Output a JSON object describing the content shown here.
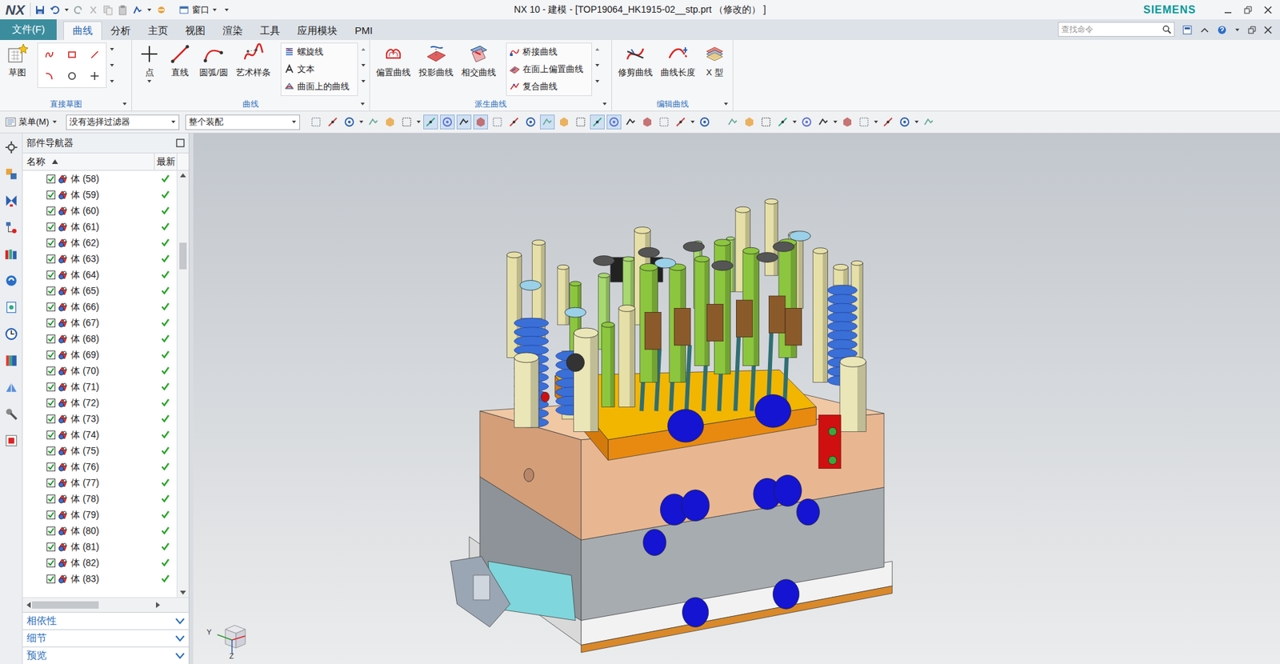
{
  "window": {
    "logo": "NX",
    "title": "NX 10 - 建模 - [TOP19064_HK1915-02__stp.prt （修改的） ]",
    "brand": "SIEMENS",
    "window_menu": "窗口"
  },
  "file_tab": "文件(F)",
  "tabs": [
    {
      "label": "曲线",
      "selected": true
    },
    {
      "label": "分析",
      "selected": false
    },
    {
      "label": "主页",
      "selected": false
    },
    {
      "label": "视图",
      "selected": false
    },
    {
      "label": "渲染",
      "selected": false
    },
    {
      "label": "工具",
      "selected": false
    },
    {
      "label": "应用模块",
      "selected": false
    },
    {
      "label": "PMI",
      "selected": false
    }
  ],
  "search": {
    "placeholder": "查找命令"
  },
  "ribbon": [
    {
      "label": "直接草图",
      "large": [
        {
          "label": "草图"
        }
      ],
      "small": []
    },
    {
      "label": "曲线",
      "large": [
        {
          "label": "点"
        },
        {
          "label": "直线"
        },
        {
          "label": "圆弧/圆"
        },
        {
          "label": "艺术样条"
        }
      ],
      "small": [
        {
          "label": "螺旋线"
        },
        {
          "label": "文本"
        },
        {
          "label": "曲面上的曲线"
        }
      ]
    },
    {
      "label": "派生曲线",
      "large": [
        {
          "label": "偏置曲线"
        },
        {
          "label": "投影曲线"
        },
        {
          "label": "相交曲线"
        }
      ],
      "small": [
        {
          "label": "桥接曲线"
        },
        {
          "label": "在面上偏置曲线"
        },
        {
          "label": "复合曲线"
        }
      ]
    },
    {
      "label": "编辑曲线",
      "large": [
        {
          "label": "修剪曲线"
        },
        {
          "label": "曲线长度"
        },
        {
          "label": "X 型"
        }
      ],
      "small": []
    }
  ],
  "toolbar": {
    "menu": "菜单(M)",
    "filter": "没有选择过滤器",
    "scope": "整个装配"
  },
  "navigator": {
    "title": "部件导航器",
    "columns": [
      "名称",
      "最新"
    ],
    "rows": [
      {
        "name": "体 (58)",
        "checked": true,
        "latest": true
      },
      {
        "name": "体 (59)",
        "checked": true,
        "latest": true
      },
      {
        "name": "体 (60)",
        "checked": true,
        "latest": true
      },
      {
        "name": "体 (61)",
        "checked": true,
        "latest": true
      },
      {
        "name": "体 (62)",
        "checked": true,
        "latest": true
      },
      {
        "name": "体 (63)",
        "checked": true,
        "latest": true
      },
      {
        "name": "体 (64)",
        "checked": true,
        "latest": true
      },
      {
        "name": "体 (65)",
        "checked": true,
        "latest": true
      },
      {
        "name": "体 (66)",
        "checked": true,
        "latest": true
      },
      {
        "name": "体 (67)",
        "checked": true,
        "latest": true
      },
      {
        "name": "体 (68)",
        "checked": true,
        "latest": true
      },
      {
        "name": "体 (69)",
        "checked": true,
        "latest": true
      },
      {
        "name": "体 (70)",
        "checked": true,
        "latest": true
      },
      {
        "name": "体 (71)",
        "checked": true,
        "latest": true
      },
      {
        "name": "体 (72)",
        "checked": true,
        "latest": true
      },
      {
        "name": "体 (73)",
        "checked": true,
        "latest": true
      },
      {
        "name": "体 (74)",
        "checked": true,
        "latest": true
      },
      {
        "name": "体 (75)",
        "checked": true,
        "latest": true
      },
      {
        "name": "体 (76)",
        "checked": true,
        "latest": true
      },
      {
        "name": "体 (77)",
        "checked": true,
        "latest": true
      },
      {
        "name": "体 (78)",
        "checked": true,
        "latest": true
      },
      {
        "name": "体 (79)",
        "checked": true,
        "latest": true
      },
      {
        "name": "体 (80)",
        "checked": true,
        "latest": true
      },
      {
        "name": "体 (81)",
        "checked": true,
        "latest": true
      },
      {
        "name": "体 (82)",
        "checked": true,
        "latest": true
      },
      {
        "name": "体 (83)",
        "checked": true,
        "latest": true
      }
    ]
  },
  "panels": [
    {
      "label": "相依性",
      "expanded": false
    },
    {
      "label": "细节",
      "expanded": false
    },
    {
      "label": "预览",
      "expanded": false
    }
  ],
  "triad": {
    "labels": [
      "Y",
      "Z"
    ]
  }
}
